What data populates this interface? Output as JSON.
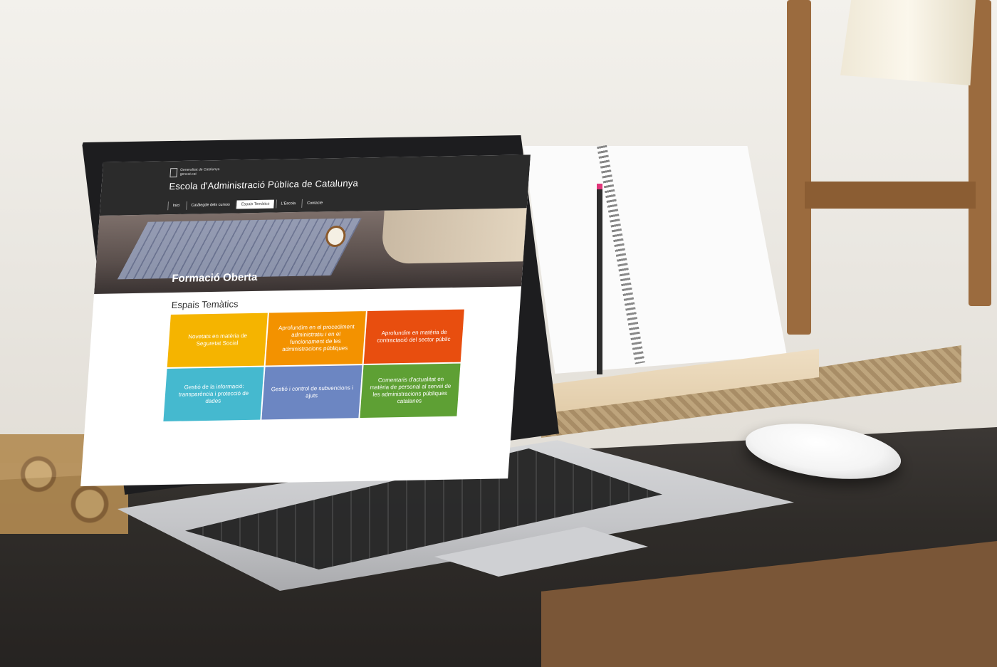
{
  "site": {
    "gov_label_1": "Generalitat de Catalunya",
    "gov_label_2": "gencat.cat",
    "title": "Escola d'Administració Pública de Catalunya"
  },
  "nav": {
    "items": [
      {
        "label": "Inici"
      },
      {
        "label": "Catàlegde dels cursos"
      },
      {
        "label": "Espais Temàtics"
      },
      {
        "label": "L'Escola"
      },
      {
        "label": "Contacte"
      }
    ]
  },
  "hero": {
    "title": "Formació Oberta"
  },
  "section": {
    "title": "Espais Temàtics",
    "intro": ""
  },
  "tiles": [
    {
      "label": "Novetats en matèria de Seguretat Social",
      "color": "#f5b400"
    },
    {
      "label": "Aprofundim en el procediment administratiu i en el funcionament de les administracions públiques",
      "color": "#f39200"
    },
    {
      "label": "Aprofundim en matèria de contractació del sector públic",
      "color": "#e84e0f"
    },
    {
      "label": "Gestió de la informació: transparència i protecció de dades",
      "color": "#45b9cf"
    },
    {
      "label": "Gestió i control de subvencions i ajuts",
      "color": "#6c86c2"
    },
    {
      "label": "Comentaris d'actualitat en matèria de personal al servei de les administracions públiques catalanes",
      "color": "#5ea034"
    }
  ]
}
